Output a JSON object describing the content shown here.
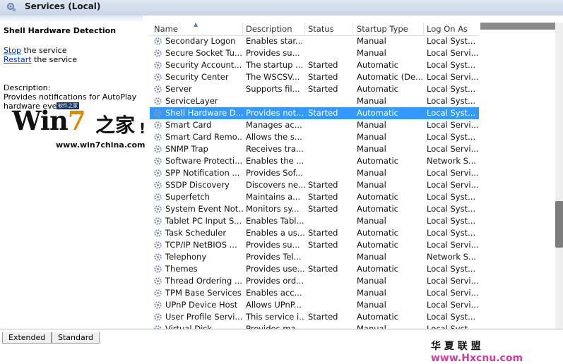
{
  "header": {
    "title": "Services (Local)"
  },
  "left_panel": {
    "service_name": "Shell Hardware Detection",
    "actions": [
      {
        "link": "Stop",
        "rest": " the service"
      },
      {
        "link": "Restart",
        "rest": " the service"
      }
    ],
    "description_label": "Description:",
    "description_text": "Provides notifications for AutoPlay hardware events."
  },
  "logo": {
    "brand_win": "Win",
    "brand_seven": "7",
    "brand_cn": "之家",
    "badge": "软件之家",
    "exclaim": "!",
    "url": "www.win7china.com"
  },
  "table": {
    "columns": [
      "Name",
      "Description",
      "Status",
      "Startup Type",
      "Log On As"
    ],
    "rows": [
      {
        "name": "Secondary Logon",
        "desc": "Enables star...",
        "status": "",
        "startup": "Manual",
        "logon": "Local Syst..."
      },
      {
        "name": "Secure Socket Tu...",
        "desc": "Provides su...",
        "status": "",
        "startup": "Manual",
        "logon": "Local Servi..."
      },
      {
        "name": "Security Account...",
        "desc": "The startup ...",
        "status": "Started",
        "startup": "Automatic",
        "logon": "Local Syst..."
      },
      {
        "name": "Security Center",
        "desc": "The WSCSV...",
        "status": "Started",
        "startup": "Automatic (De...",
        "logon": "Local Servi..."
      },
      {
        "name": "Server",
        "desc": "Supports fil...",
        "status": "Started",
        "startup": "Automatic",
        "logon": "Local Syst..."
      },
      {
        "name": "ServiceLayer",
        "desc": "",
        "status": "",
        "startup": "Manual",
        "logon": "Local Syst..."
      },
      {
        "name": "Shell Hardware D...",
        "desc": "Provides not...",
        "status": "Started",
        "startup": "Automatic",
        "logon": "Local Syst...",
        "selected": true
      },
      {
        "name": "Smart Card",
        "desc": "Manages ac...",
        "status": "",
        "startup": "Manual",
        "logon": "Local Servi..."
      },
      {
        "name": "Smart Card Remo...",
        "desc": "Allows the s...",
        "status": "",
        "startup": "Manual",
        "logon": "Local Syst..."
      },
      {
        "name": "SNMP Trap",
        "desc": "Receives tra...",
        "status": "",
        "startup": "Manual",
        "logon": "Local Servi..."
      },
      {
        "name": "Software Protecti...",
        "desc": "Enables the ...",
        "status": "",
        "startup": "Automatic",
        "logon": "Network S..."
      },
      {
        "name": "SPP Notification ...",
        "desc": "Provides Sof...",
        "status": "",
        "startup": "Manual",
        "logon": "Local Servi..."
      },
      {
        "name": "SSDP Discovery",
        "desc": "Discovers ne...",
        "status": "Started",
        "startup": "Manual",
        "logon": "Local Servi..."
      },
      {
        "name": "Superfetch",
        "desc": "Maintains a...",
        "status": "Started",
        "startup": "Automatic",
        "logon": "Local Syst..."
      },
      {
        "name": "System Event Not...",
        "desc": "Monitors sy...",
        "status": "Started",
        "startup": "Automatic",
        "logon": "Local Syst..."
      },
      {
        "name": "Tablet PC Input S...",
        "desc": "Enables Tabl...",
        "status": "",
        "startup": "Manual",
        "logon": "Local Syst..."
      },
      {
        "name": "Task Scheduler",
        "desc": "Enables a us...",
        "status": "Started",
        "startup": "Automatic",
        "logon": "Local Syst..."
      },
      {
        "name": "TCP/IP NetBIOS ...",
        "desc": "Provides su...",
        "status": "Started",
        "startup": "Automatic",
        "logon": "Local Servi..."
      },
      {
        "name": "Telephony",
        "desc": "Provides Tel...",
        "status": "",
        "startup": "Manual",
        "logon": "Network S..."
      },
      {
        "name": "Themes",
        "desc": "Provides use...",
        "status": "Started",
        "startup": "Automatic",
        "logon": "Local Syst..."
      },
      {
        "name": "Thread Ordering ...",
        "desc": "Provides ord...",
        "status": "",
        "startup": "Manual",
        "logon": "Local Servi..."
      },
      {
        "name": "TPM Base Services",
        "desc": "Enables acc...",
        "status": "",
        "startup": "Manual",
        "logon": "Local Servi..."
      },
      {
        "name": "UPnP Device Host",
        "desc": "Allows UPnP...",
        "status": "",
        "startup": "Manual",
        "logon": "Local Servi..."
      },
      {
        "name": "User Profile Servi...",
        "desc": "This service i...",
        "status": "Started",
        "startup": "Automatic",
        "logon": "Local Syst..."
      },
      {
        "name": "Virtual Disk",
        "desc": "Provides ma...",
        "status": "",
        "startup": "Manual",
        "logon": "Local Syst..."
      }
    ]
  },
  "tabs": [
    "Extended",
    "Standard"
  ],
  "watermark": {
    "zh": "华 夏 联 盟",
    "url": "www.Hxcnu.com"
  },
  "colors": {
    "selection": "#3399ff",
    "link": "#0033cc",
    "header_bg": "#dfe6f2"
  }
}
